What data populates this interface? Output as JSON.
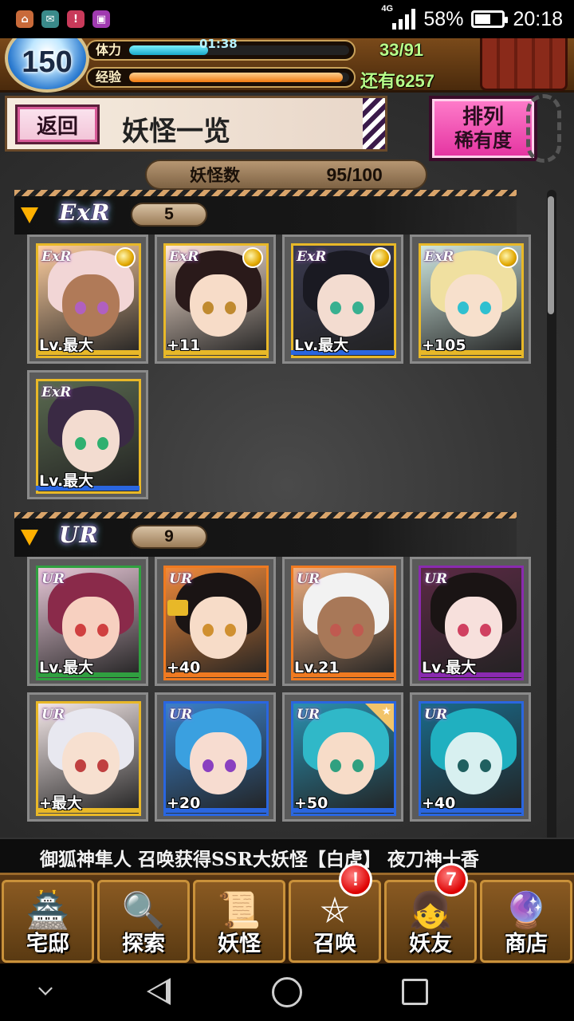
{
  "status_bar": {
    "network": "4G",
    "battery": "58%",
    "battery_level": 0.58,
    "time": "20:18",
    "notification_icons": [
      "app-icon",
      "mail-icon",
      "warning-icon",
      "gallery-icon"
    ]
  },
  "player": {
    "level": "150",
    "stamina_label": "体力",
    "stamina_timer": "01:38",
    "stamina_value": "33/91",
    "stamina_fraction": 0.36,
    "exp_label": "经验",
    "exp_remaining": "还有6257",
    "exp_fraction": 0.97
  },
  "header": {
    "back_label": "返回",
    "title": "妖怪一览",
    "sort_label": "排列",
    "sort_value": "稀有度"
  },
  "yokai_count": {
    "label": "妖怪数",
    "value": "95/100"
  },
  "sections": [
    {
      "rarity": "ExR",
      "count": "5",
      "cards": [
        {
          "rarity": "ExR",
          "label": "Lv.最大",
          "medal": true,
          "hair": "#f2d6d6",
          "eyes": "#b060c0",
          "skin": "#b07a58",
          "bg": "#ffcfa0",
          "frame": "#e8b828",
          "strip": "#e8b828"
        },
        {
          "rarity": "ExR",
          "label": "+11",
          "medal": true,
          "hair": "#2a1a1a",
          "eyes": "#c08a30",
          "skin": "#f7dcc8",
          "bg": "#ffe8d8",
          "frame": "#e8b828",
          "strip": "#e8b828"
        },
        {
          "rarity": "ExR",
          "label": "Lv.最大",
          "medal": true,
          "hair": "#1a1a22",
          "eyes": "#38b090",
          "skin": "#f3dcd0",
          "bg": "#3a3a50",
          "frame": "#e8b828",
          "strip": "#2a66e0"
        },
        {
          "rarity": "ExR",
          "label": "+105",
          "medal": true,
          "hair": "#f0e0a0",
          "eyes": "#30c0d0",
          "skin": "#f7e0cc",
          "bg": "#cfe8e0",
          "frame": "#e8b828",
          "strip": "#e8b828"
        },
        {
          "rarity": "ExR",
          "label": "Lv.最大",
          "medal": false,
          "hair": "#3a2a44",
          "eyes": "#30b070",
          "skin": "#f3dcd0",
          "bg": "#5a6a50",
          "frame": "#e8b828",
          "strip": "#2a66e0"
        }
      ]
    },
    {
      "rarity": "UR",
      "count": "9",
      "cards": [
        {
          "rarity": "UR",
          "label": "Lv.最大",
          "medal": false,
          "hair": "#8a2a4a",
          "eyes": "#d04040",
          "skin": "#f7d0c0",
          "bg": "#e8c8d8",
          "frame": "#30a040",
          "strip": "#30a040"
        },
        {
          "rarity": "UR",
          "label": "+40",
          "medal": false,
          "lock": true,
          "hair": "#1a1414",
          "eyes": "#d09030",
          "skin": "#f7dcc8",
          "bg": "#f08a3a",
          "frame": "#f07a20",
          "strip": "#f07a20"
        },
        {
          "rarity": "UR",
          "label": "Lv.21",
          "medal": false,
          "hair": "#f2f2f2",
          "eyes": "#c05a50",
          "skin": "#a87858",
          "bg": "#f0b080",
          "frame": "#f07a20",
          "strip": "#f07a20"
        },
        {
          "rarity": "UR",
          "label": "Lv.最大",
          "medal": false,
          "hair": "#1a1414",
          "eyes": "#d04060",
          "skin": "#f7e0dc",
          "bg": "#5a2a44",
          "frame": "#8a2ab0",
          "strip": "#8a2ab0"
        },
        {
          "rarity": "UR",
          "label": "+最大",
          "medal": false,
          "hair": "#e8e8f0",
          "eyes": "#c04040",
          "skin": "#f7e0d0",
          "bg": "#f4e8e8",
          "frame": "#e8b828",
          "strip": "#e8b828"
        },
        {
          "rarity": "UR",
          "label": "+20",
          "medal": false,
          "hair": "#3aa0e0",
          "eyes": "#8a40c0",
          "skin": "#f7dcd0",
          "bg": "#3a80c8",
          "frame": "#2a66e0",
          "strip": "#2a66e0"
        },
        {
          "rarity": "UR",
          "label": "+50",
          "medal": false,
          "star": true,
          "hair": "#30b8c8",
          "eyes": "#30a080",
          "skin": "#f7dcc8",
          "bg": "#2a90b0",
          "frame": "#2a66e0",
          "strip": "#2a66e0"
        },
        {
          "rarity": "UR",
          "label": "+40",
          "medal": false,
          "hair": "#20b0c0",
          "eyes": "#206060",
          "skin": "#d8f0f0",
          "bg": "#1a6a8a",
          "frame": "#2a66e0",
          "strip": "#2a66e0"
        }
      ]
    }
  ],
  "ticker": "御狐神隼人 召唤获得SSR大妖怪【白虎】 夜刀神十香",
  "nav": [
    {
      "label": "宅邸",
      "icon": "house-icon",
      "glyph": "🏯",
      "badge": ""
    },
    {
      "label": "探索",
      "icon": "magnifier-icon",
      "glyph": "🔍",
      "badge": ""
    },
    {
      "label": "妖怪",
      "icon": "scroll-icon",
      "glyph": "📜",
      "badge": ""
    },
    {
      "label": "召唤",
      "icon": "pentagram-icon",
      "glyph": "⛤",
      "badge": "!"
    },
    {
      "label": "妖友",
      "icon": "friend-icon",
      "glyph": "👧",
      "badge": "7"
    },
    {
      "label": "商店",
      "icon": "crystal-ball-icon",
      "glyph": "🔮",
      "badge": ""
    }
  ]
}
